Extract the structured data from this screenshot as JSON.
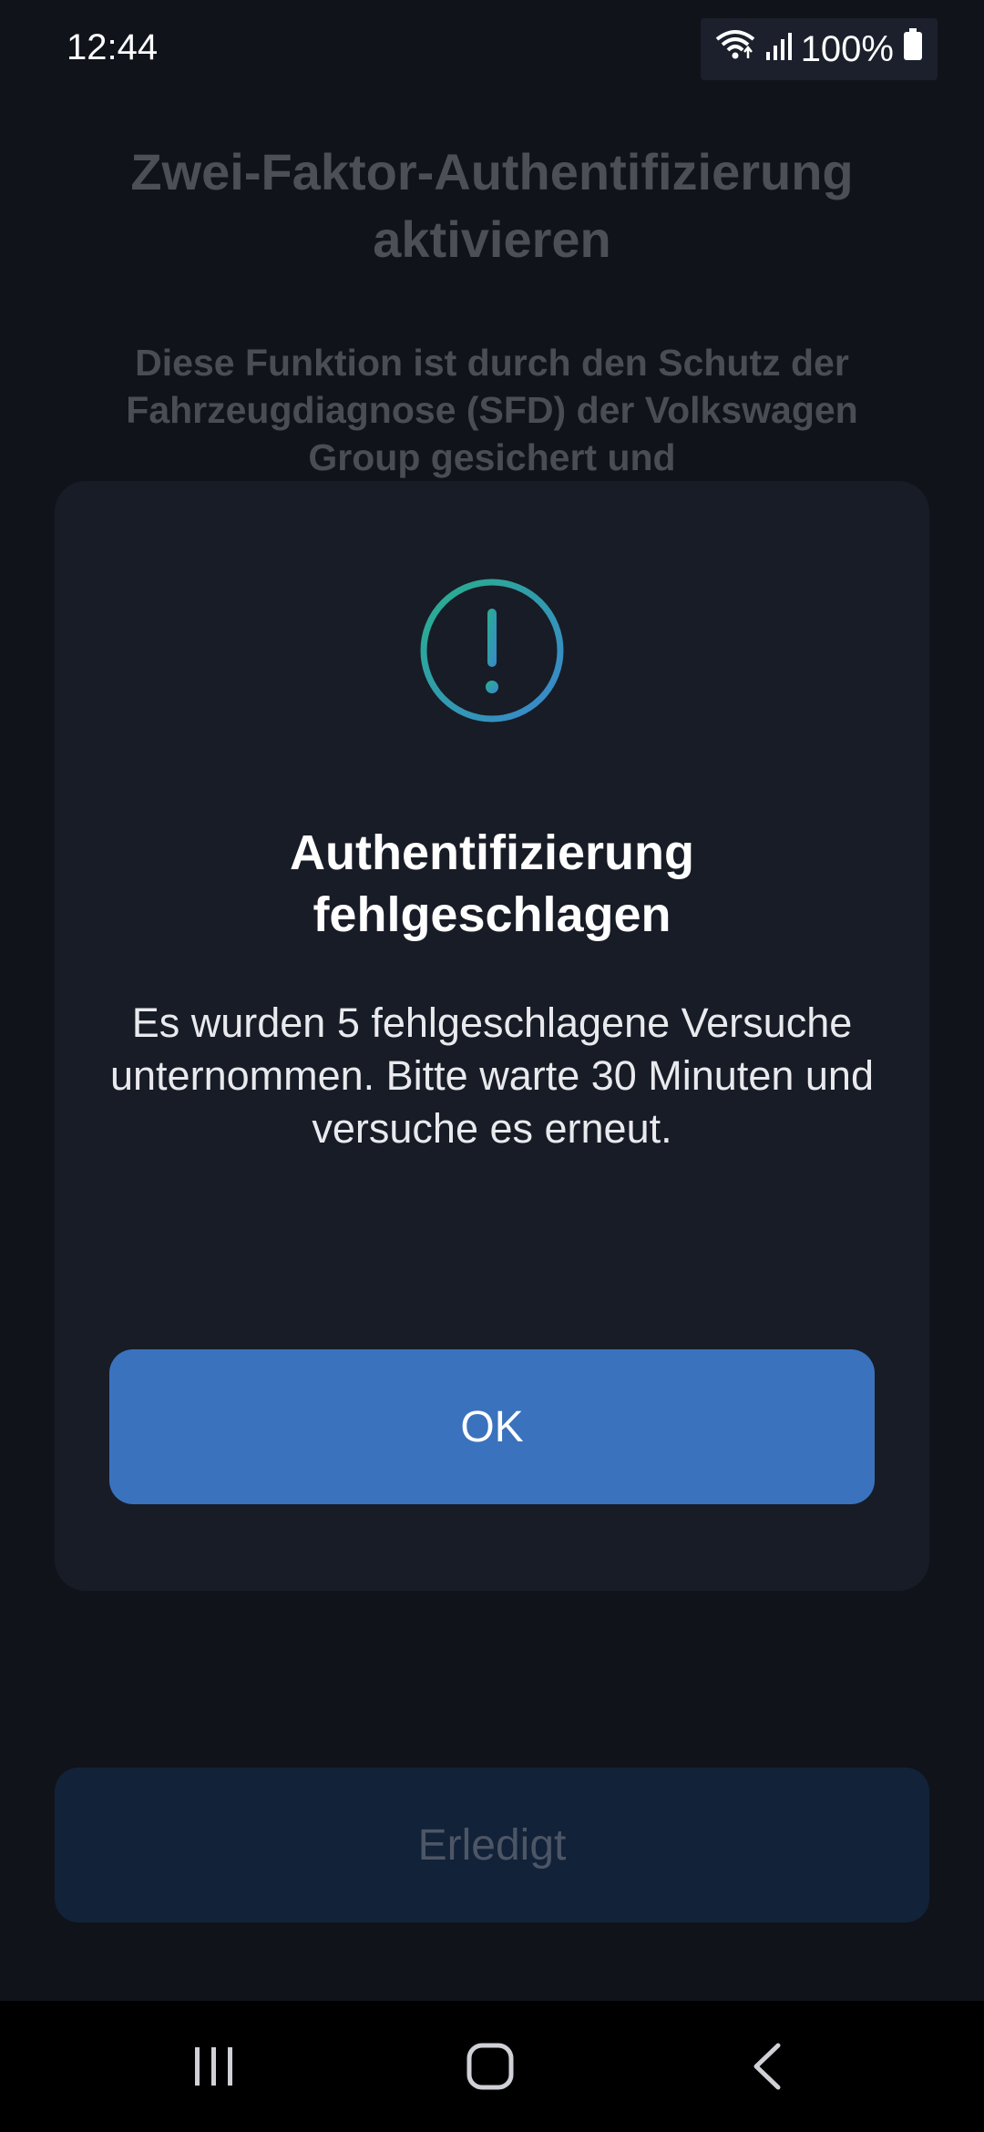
{
  "status_bar": {
    "time": "12:44",
    "battery": "100%",
    "icons": [
      "wifi-icon",
      "signal-icon",
      "battery-icon"
    ]
  },
  "background_page": {
    "title": "Zwei-Faktor-Authentifizierung aktivieren",
    "description": "Diese Funktion ist durch den Schutz der Fahrzeugdiagnose (SFD) der Volkswagen Group gesichert und",
    "done_button": "Erledigt"
  },
  "dialog": {
    "icon": "alert-icon",
    "title": "Authentifizierung fehlgeschlagen",
    "message": "Es wurden 5 fehlgeschlagene Versuche unternommen. Bitte warte 30 Minuten und versuche es erneut.",
    "ok_button": "OK"
  },
  "nav_bar": {
    "icons": [
      "recent-apps-icon",
      "home-icon",
      "back-icon"
    ]
  },
  "colors": {
    "accent": "#3a72bd",
    "icon_gradient_start": "#28b08c",
    "icon_gradient_end": "#3a86d0"
  }
}
